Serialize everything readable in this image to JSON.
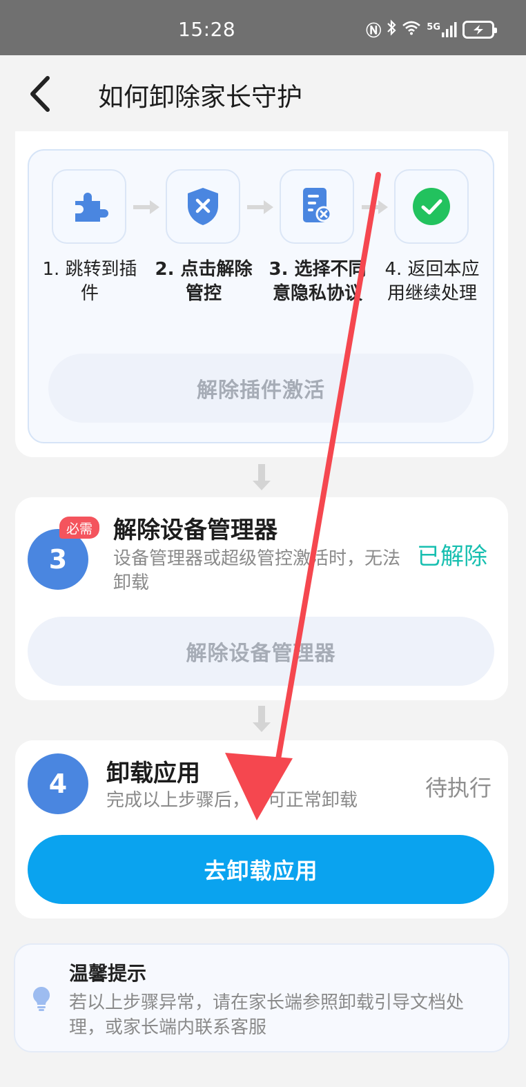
{
  "status_bar": {
    "time": "15:28",
    "network": "5G"
  },
  "header": {
    "title": "如何卸除家长守护",
    "back_icon": "chevron-left-icon"
  },
  "plugin_section": {
    "steps": [
      {
        "label": "1. 跳转到插件",
        "icon": "puzzle-icon"
      },
      {
        "label": "2. 点击解除管控",
        "icon": "shield-x-icon"
      },
      {
        "label": "3. 选择不同意隐私协议",
        "icon": "document-x-icon"
      },
      {
        "label": "4. 返回本应用继续处理",
        "icon": "check-circle-icon"
      }
    ],
    "button_label": "解除插件激活"
  },
  "device_admin": {
    "number": "3",
    "badge": "必需",
    "title": "解除设备管理器",
    "description": "设备管理器或超级管控激活时，无法卸载",
    "status": "已解除",
    "button_label": "解除设备管理器"
  },
  "uninstall": {
    "number": "4",
    "title": "卸载应用",
    "description": "完成以上步骤后，即可正常卸载",
    "status": "待执行",
    "button_label": "去卸载应用"
  },
  "tips": {
    "title": "温馨提示",
    "text": "若以上步骤异常，请在家长端参照卸载引导文档处理，或家长端内联系客服",
    "icon": "lightbulb-icon"
  },
  "colors": {
    "accent": "#0aa3ef",
    "step_circle": "#4a86e0",
    "done": "#17bfb0",
    "badge": "#f4545d",
    "annotation_arrow": "#f5474f"
  }
}
